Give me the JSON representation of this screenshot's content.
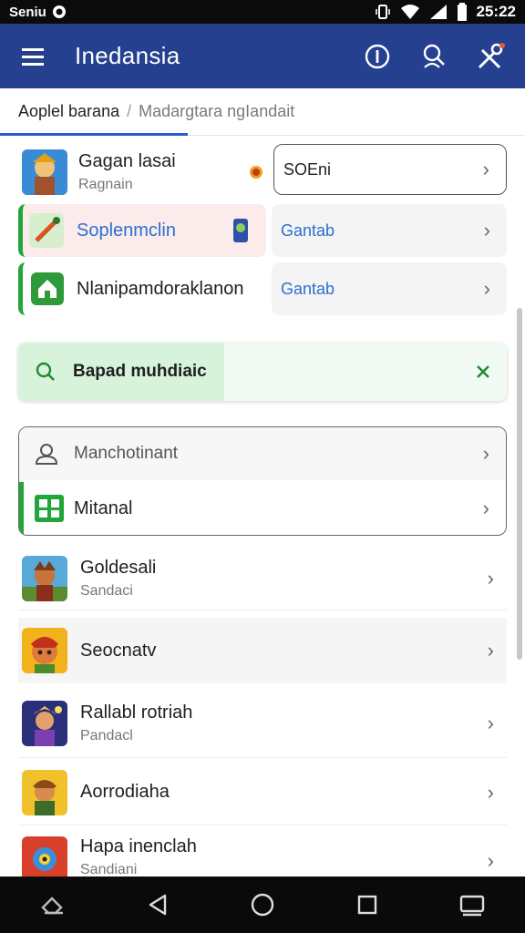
{
  "status": {
    "carrier": "Seniu",
    "time": "25:22"
  },
  "appbar": {
    "title": "Inedansia"
  },
  "crumbs": {
    "active": "Aoplel barana",
    "separator": "/",
    "inactive": "Madargtara ngIandait"
  },
  "top_rows": [
    {
      "name": "Gagan lasai",
      "sub": "Ragnain",
      "chip": "SOEni"
    },
    {
      "name": "Soplenmclin",
      "tag": "Gantab"
    },
    {
      "name": "Nlanipamdoraklanon",
      "tag": "Gantab"
    }
  ],
  "search": {
    "value": "Bapad muhdiaic"
  },
  "group": [
    {
      "name": "Manchotinant"
    },
    {
      "name": "Mitanal"
    }
  ],
  "games": [
    {
      "name": "Goldesali",
      "sub": "Sandaci"
    },
    {
      "name": "Seocnatv",
      "sub": ""
    },
    {
      "name": "Rallabl rotriah",
      "sub": "Pandacl"
    },
    {
      "name": "Aorrodiaha",
      "sub": ""
    },
    {
      "name": "Hapa inenclah",
      "sub": "Sandiani"
    }
  ],
  "colors": {
    "appbar": "#24408f",
    "accent_green": "#22a63a",
    "link_blue": "#2c6fd1",
    "tab_underline": "#2a5bd7"
  }
}
